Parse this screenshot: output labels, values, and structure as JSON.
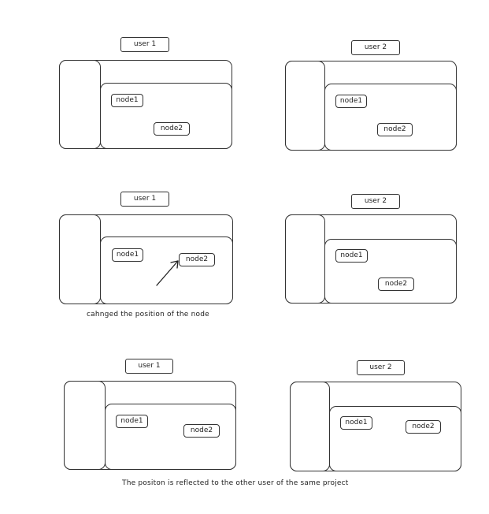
{
  "rows": [
    {
      "left": {
        "user_label": "user 1",
        "nodes": [
          {
            "label": "node1"
          },
          {
            "label": "node2"
          }
        ]
      },
      "right": {
        "user_label": "user 2",
        "nodes": [
          {
            "label": "node1"
          },
          {
            "label": "node2"
          }
        ]
      }
    },
    {
      "left": {
        "user_label": "user 1",
        "nodes": [
          {
            "label": "node1"
          },
          {
            "label": "node2"
          }
        ]
      },
      "right": {
        "user_label": "user 2",
        "nodes": [
          {
            "label": "node1"
          },
          {
            "label": "node2"
          }
        ]
      },
      "caption": "cahnged the position of the node"
    },
    {
      "left": {
        "user_label": "user 1",
        "nodes": [
          {
            "label": "node1"
          },
          {
            "label": "node2"
          }
        ]
      },
      "right": {
        "user_label": "user 2",
        "nodes": [
          {
            "label": "node1"
          },
          {
            "label": "node2"
          }
        ]
      },
      "caption": "The positon is reflected to the other user of the same project"
    }
  ]
}
